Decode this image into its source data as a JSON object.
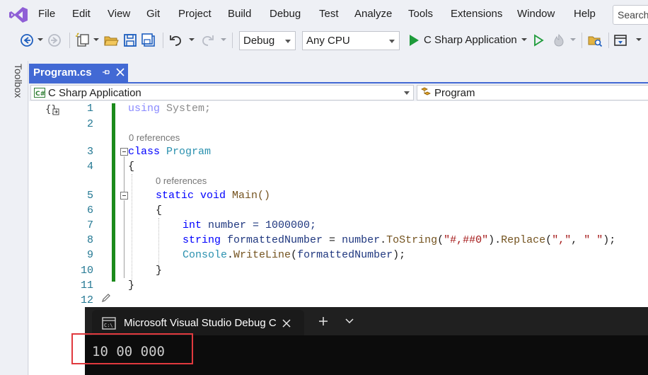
{
  "menu": {
    "items": [
      "File",
      "Edit",
      "View",
      "Git",
      "Project",
      "Build",
      "Debug",
      "Test",
      "Analyze",
      "Tools",
      "Extensions",
      "Window",
      "Help"
    ],
    "search_placeholder": "Search"
  },
  "toolbar": {
    "configuration": "Debug",
    "platform": "Any CPU",
    "startup_project": "C Sharp Application"
  },
  "side_panel": {
    "toolbox_label": "Toolbox"
  },
  "editor_tab": {
    "title": "Program.cs"
  },
  "nav_bar": {
    "project": "C Sharp Application",
    "class": "Program"
  },
  "code": {
    "line_numbers": [
      "1",
      "2",
      "3",
      "4",
      "5",
      "6",
      "7",
      "8",
      "9",
      "10",
      "11",
      "12"
    ],
    "refs_class": "0 references",
    "refs_main": "0 references",
    "using": "using",
    "system": " System;",
    "class_kw": "class",
    "class_name": " Program",
    "brace_open": "{",
    "brace_close": "}",
    "static_kw": "static",
    "void_kw": " void",
    "main_sig": " Main()",
    "int_kw": "int",
    "line7_rest": " number = 1000000;",
    "string_kw": "string",
    "var_formatted": " formattedNumber",
    "assign": " = ",
    "number_ident": "number",
    "dot": ".",
    "tostring": "ToString",
    "paren_open": "(",
    "format_str": "\"#,##0\"",
    "paren_close_dot": ").",
    "replace": "Replace",
    "comma_str": "\",\"",
    "sep": ", ",
    "space_str": "\" \"",
    "line8_end": ");",
    "console_type": "Console",
    "writeline": "WriteLine",
    "formatted_arg": "formattedNumber",
    "line9_end": ");"
  },
  "console": {
    "title": "Microsoft Visual Studio Debug Console",
    "output": "10 00 000"
  },
  "colors": {
    "tab_active": "#4269d4",
    "keyword": "#0000ff",
    "type": "#2b91af",
    "string": "#a31515",
    "change_bar": "#1b8a1b",
    "highlight": "#e0393e"
  }
}
